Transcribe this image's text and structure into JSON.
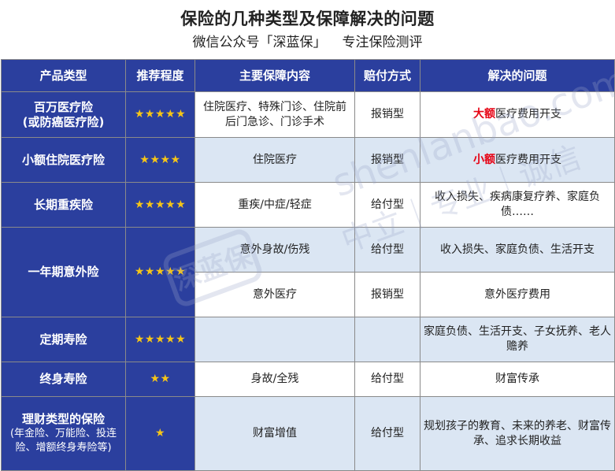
{
  "header": {
    "title": "保险的几种类型及保障解决的问题",
    "subtitle_left": "微信公众号「深蓝保」",
    "subtitle_right": "专注保险测评"
  },
  "table": {
    "columns": [
      "产品类型",
      "推荐程度",
      "主要保障内容",
      "赔付方式",
      "解决的问题"
    ],
    "rows": {
      "r0": {
        "type": "百万医疗险",
        "type_sub": "(或防癌医疗险)",
        "stars": "★★★★★",
        "coverage": "住院医疗、特殊门诊、住院前后门急诊、门诊手术",
        "payout": "报销型",
        "problem_em": "大额",
        "problem": "医疗费用开支"
      },
      "r1": {
        "type": "小额住院医疗险",
        "stars": "★★★★",
        "coverage": "住院医疗",
        "payout": "报销型",
        "problem_em": "小额",
        "problem": "医疗费用开支"
      },
      "r2": {
        "type": "长期重疾险",
        "stars": "★★★★★",
        "coverage": "重疾/中症/轻症",
        "payout": "给付型",
        "problem": "收入损失、疾病康复疗养、家庭负债……"
      },
      "r3": {
        "type": "一年期意外险",
        "stars": "★★★★★",
        "coverage": "意外身故/伤残",
        "payout": "给付型",
        "problem": "收入损失、家庭负债、生活开支"
      },
      "r3b": {
        "coverage": "意外医疗",
        "payout": "报销型",
        "problem": "意外医疗费用"
      },
      "r4": {
        "type": "定期寿险",
        "stars": "★★★★★",
        "coverage": "",
        "payout": "",
        "problem": "家庭负债、生活开支、子女抚养、老人赡养"
      },
      "r5": {
        "type": "终身寿险",
        "stars": "★★",
        "coverage": "身故/全残",
        "payout": "给付型",
        "problem": "财富传承"
      },
      "r6": {
        "type": "理财类型的保险",
        "type_sub": "(年金险、万能险、投连险、增额终身寿险等)",
        "stars": "★",
        "coverage": "财富增值",
        "payout": "给付型",
        "problem": "规划孩子的教育、未来的养老、财富传承、追求长期收益"
      }
    }
  },
  "watermark": {
    "text_en": "shenlanbao.com",
    "text_cn": "中立｜专业｜诚信",
    "logo_text": "深蓝保",
    "color": "#9aa6c8"
  },
  "colors": {
    "header_bg": "#2b3f9e",
    "row_alt_bg": "#dbe6f3",
    "star": "#f5c518",
    "emphasis_red": "#e60012"
  }
}
